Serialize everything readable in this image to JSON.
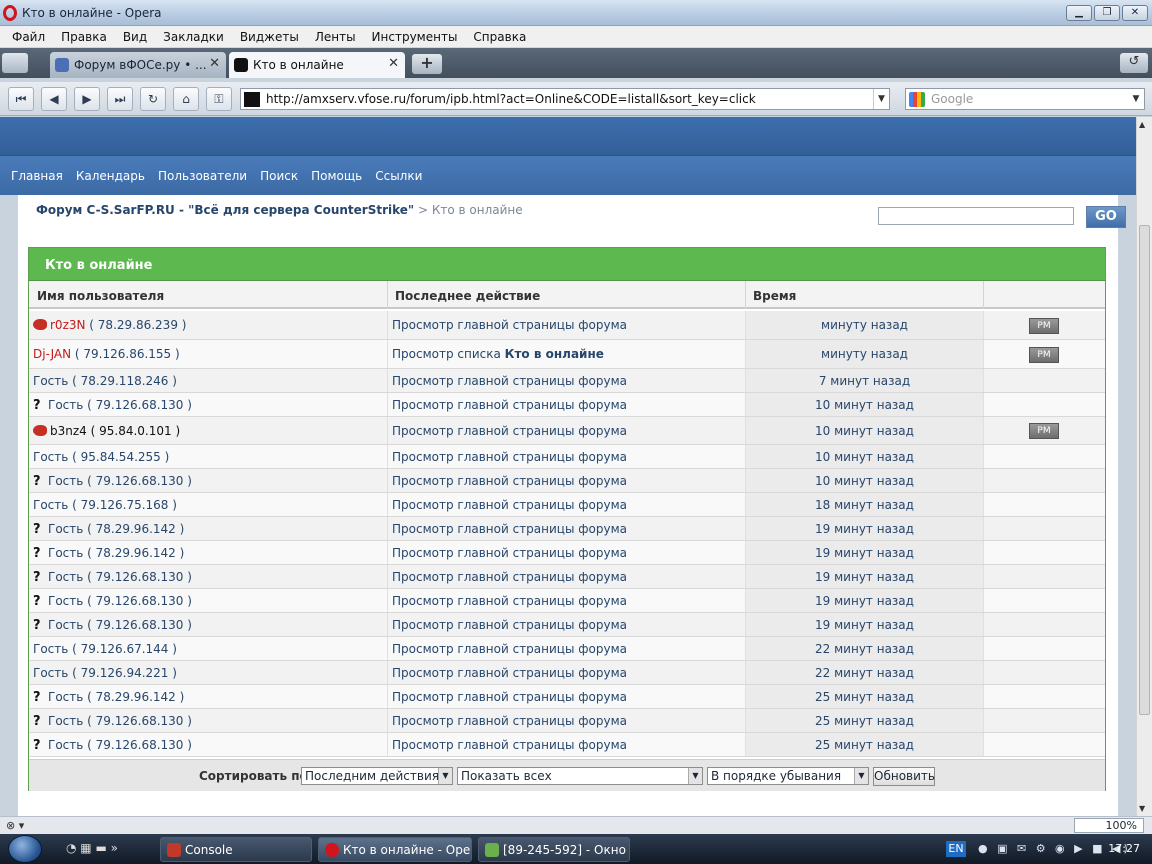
{
  "window": {
    "title": "Кто в онлайне - Opera"
  },
  "menu": [
    "Файл",
    "Правка",
    "Вид",
    "Закладки",
    "Виджеты",
    "Ленты",
    "Инструменты",
    "Справка"
  ],
  "tabs": [
    {
      "label": "Форум вФОСе.ру • ..."
    },
    {
      "label": "Кто в онлайне"
    }
  ],
  "address": {
    "url": "http://amxserv.vfose.ru/forum/ipb.html?act=Online&CODE=listall&sort_key=click"
  },
  "search": {
    "placeholder": "Google"
  },
  "nav": [
    "Главная",
    "Календарь",
    "Пользователи",
    "Поиск",
    "Помощь",
    "Ссылки"
  ],
  "breadcrumb": {
    "forum": "Форум C-S.SarFP.RU - \"Всё для сервера CounterStrike\"",
    "current": "> Кто в онлайне"
  },
  "go_label": "GO",
  "panel": {
    "title": "Кто в онлайне",
    "columns": [
      "Имя пользователя",
      "Последнее действие",
      "Время"
    ],
    "pm_label": "PM",
    "rows": [
      {
        "icon": "bird",
        "name": "r0z3N",
        "ip": "( 78.29.86.239 )",
        "action": "Просмотр главной страницы форума",
        "action_bold": "",
        "time": "минуту назад",
        "pm": true,
        "style": "red"
      },
      {
        "icon": "none",
        "name": "Dj-JAN",
        "ip": "( 79.126.86.155 )",
        "action": "Просмотр списка ",
        "action_bold": "Кто в онлайне",
        "time": "минуту назад",
        "pm": true,
        "style": "red"
      },
      {
        "icon": "none",
        "name": "Гость",
        "ip": "( 78.29.118.246 )",
        "action": "Просмотр главной страницы форума",
        "action_bold": "",
        "time": "7 минут назад",
        "pm": false,
        "style": "guest"
      },
      {
        "icon": "question",
        "name": "Гость",
        "ip": "( 79.126.68.130 )",
        "action": "Просмотр главной страницы форума",
        "action_bold": "",
        "time": "10 минут назад",
        "pm": false,
        "style": "guest"
      },
      {
        "icon": "bird",
        "name": "b3nz4",
        "ip": "( 95.84.0.101 )",
        "action": "Просмотр главной страницы форума",
        "action_bold": "",
        "time": "10 минут назад",
        "pm": true,
        "style": "dark"
      },
      {
        "icon": "none",
        "name": "Гость",
        "ip": "( 95.84.54.255 )",
        "action": "Просмотр главной страницы форума",
        "action_bold": "",
        "time": "10 минут назад",
        "pm": false,
        "style": "guest"
      },
      {
        "icon": "question",
        "name": "Гость",
        "ip": "( 79.126.68.130 )",
        "action": "Просмотр главной страницы форума",
        "action_bold": "",
        "time": "10 минут назад",
        "pm": false,
        "style": "guest"
      },
      {
        "icon": "none",
        "name": "Гость",
        "ip": "( 79.126.75.168 )",
        "action": "Просмотр главной страницы форума",
        "action_bold": "",
        "time": "18 минут назад",
        "pm": false,
        "style": "guest"
      },
      {
        "icon": "question",
        "name": "Гость",
        "ip": "( 78.29.96.142 )",
        "action": "Просмотр главной страницы форума",
        "action_bold": "",
        "time": "19 минут назад",
        "pm": false,
        "style": "guest"
      },
      {
        "icon": "question",
        "name": "Гость",
        "ip": "( 78.29.96.142 )",
        "action": "Просмотр главной страницы форума",
        "action_bold": "",
        "time": "19 минут назад",
        "pm": false,
        "style": "guest"
      },
      {
        "icon": "question",
        "name": "Гость",
        "ip": "( 79.126.68.130 )",
        "action": "Просмотр главной страницы форума",
        "action_bold": "",
        "time": "19 минут назад",
        "pm": false,
        "style": "guest"
      },
      {
        "icon": "question",
        "name": "Гость",
        "ip": "( 79.126.68.130 )",
        "action": "Просмотр главной страницы форума",
        "action_bold": "",
        "time": "19 минут назад",
        "pm": false,
        "style": "guest"
      },
      {
        "icon": "question",
        "name": "Гость",
        "ip": "( 79.126.68.130 )",
        "action": "Просмотр главной страницы форума",
        "action_bold": "",
        "time": "19 минут назад",
        "pm": false,
        "style": "guest"
      },
      {
        "icon": "none",
        "name": "Гость",
        "ip": "( 79.126.67.144 )",
        "action": "Просмотр главной страницы форума",
        "action_bold": "",
        "time": "22 минут назад",
        "pm": false,
        "style": "guest"
      },
      {
        "icon": "none",
        "name": "Гость",
        "ip": "( 79.126.94.221 )",
        "action": "Просмотр главной страницы форума",
        "action_bold": "",
        "time": "22 минут назад",
        "pm": false,
        "style": "guest"
      },
      {
        "icon": "question",
        "name": "Гость",
        "ip": "( 78.29.96.142 )",
        "action": "Просмотр главной страницы форума",
        "action_bold": "",
        "time": "25 минут назад",
        "pm": false,
        "style": "guest"
      },
      {
        "icon": "question",
        "name": "Гость",
        "ip": "( 79.126.68.130 )",
        "action": "Просмотр главной страницы форума",
        "action_bold": "",
        "time": "25 минут назад",
        "pm": false,
        "style": "guest"
      },
      {
        "icon": "question",
        "name": "Гость",
        "ip": "( 79.126.68.130 )",
        "action": "Просмотр главной страницы форума",
        "action_bold": "",
        "time": "25 минут назад",
        "pm": false,
        "style": "guest"
      }
    ]
  },
  "sort": {
    "label": "Сортировать по:",
    "sort_key": "Последним действиям",
    "show": "Показать всех",
    "order": "В порядке убывания",
    "update": "Обновить"
  },
  "status": {
    "zoom": "100%"
  },
  "taskbar": {
    "tasks": [
      "Console",
      "Кто в онлайне - Opera",
      "[89-245-592] - Окно ..."
    ],
    "lang": "EN",
    "clock": "17:27"
  },
  "colors": {
    "panel_header": "#5cb84f",
    "nav_blue": "#3c6aa4",
    "member_red": "#c41a1a",
    "link": "#27466b"
  }
}
